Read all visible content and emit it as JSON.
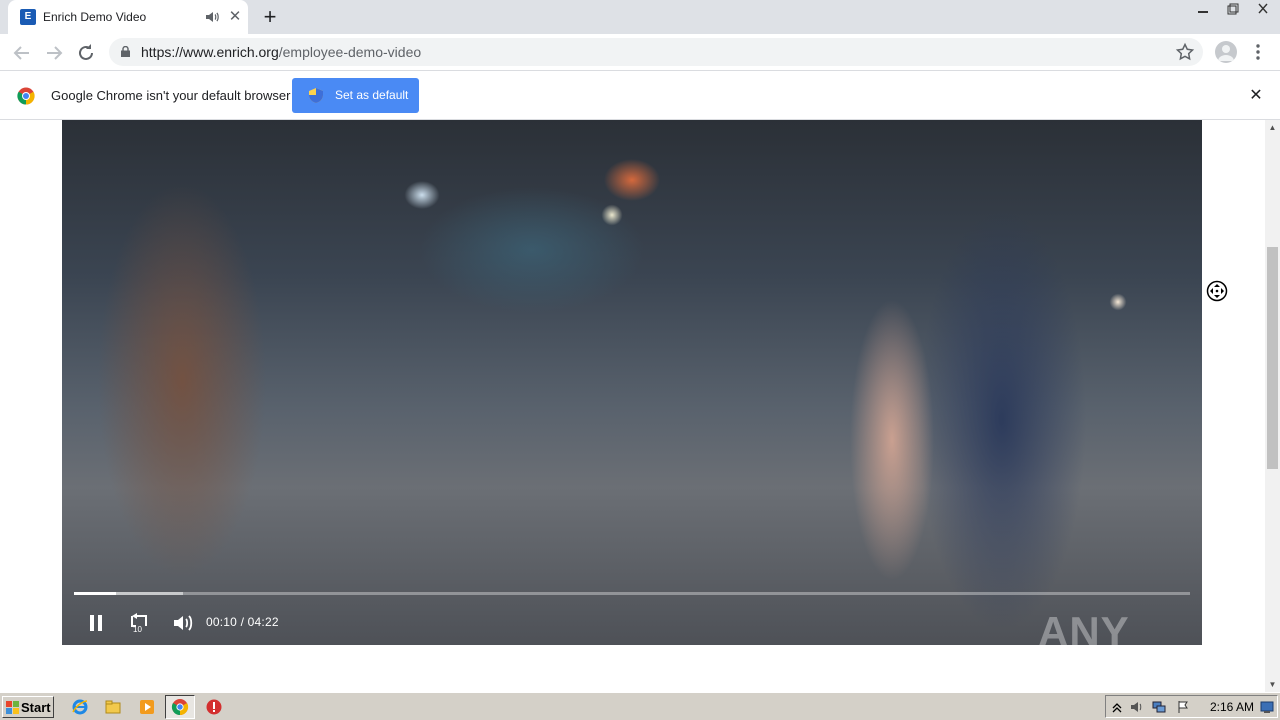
{
  "browser": {
    "tab": {
      "title": "Enrich Demo Video",
      "favicon_text": "E"
    },
    "url": {
      "domain": "https://www.enrich.org",
      "path": "/employee-demo-video"
    },
    "icons": [
      "back-icon",
      "forward-icon",
      "reload-icon",
      "lock-icon",
      "star-icon",
      "profile-icon",
      "menu-icon",
      "audio-icon",
      "close-icon",
      "plus-icon"
    ]
  },
  "infobar": {
    "message": "Google Chrome isn't your default browser",
    "button_label": "Set as default"
  },
  "player": {
    "current_time": "00:10",
    "separator": "/",
    "duration": "04:22",
    "progress_fraction": 0.038,
    "buffered_fraction": 0.098,
    "skip_back_label": "10",
    "watermark": "ANY RUN",
    "state": "playing"
  },
  "taskbar": {
    "start_label": "Start",
    "clock": "2:16 AM",
    "apps": [
      "ie-icon",
      "explorer-icon",
      "media-player-icon",
      "chrome-icon",
      "stop-icon"
    ]
  }
}
